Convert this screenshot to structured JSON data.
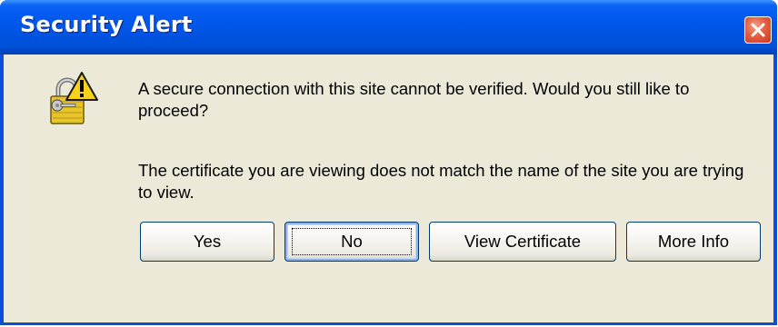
{
  "window": {
    "title": "Security Alert"
  },
  "icons": {
    "close": "close-icon",
    "alert": "security-lock-warning-icon"
  },
  "message": {
    "line1": "A secure connection with this site cannot be verified. Would you still like to proceed?",
    "line2": "The certificate you are viewing does not match the name of the site you are trying to view."
  },
  "buttons": {
    "yes": "Yes",
    "no": "No",
    "view_certificate": "View Certificate",
    "more_info": "More Info"
  },
  "colors": {
    "titlebar": "#0054e3",
    "dialog_background": "#ece9d8",
    "close_button": "#e5603f"
  }
}
